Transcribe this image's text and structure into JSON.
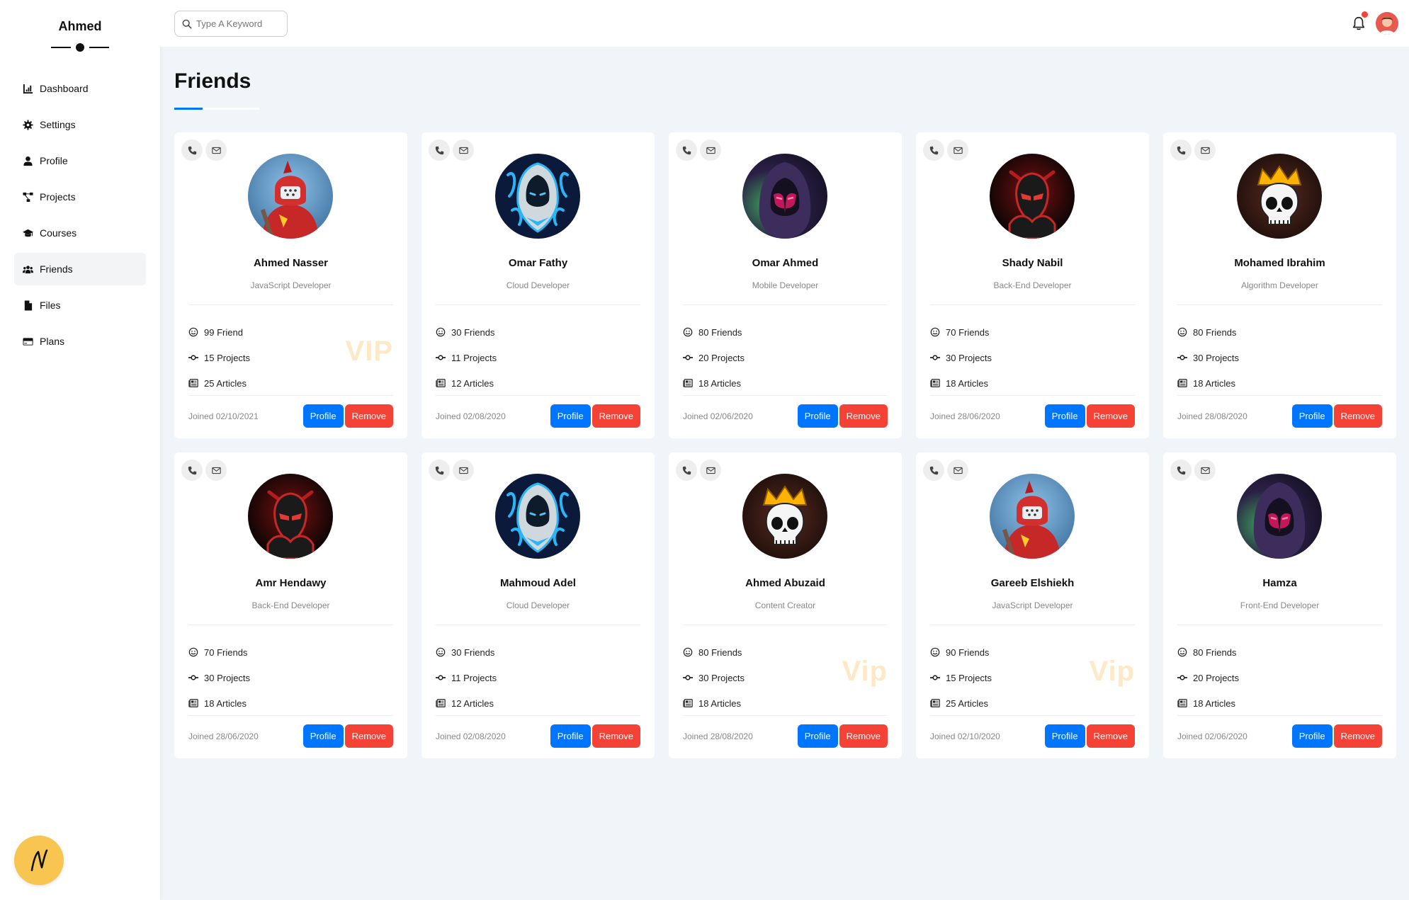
{
  "sidebar": {
    "brand": "Ahmed",
    "items": [
      {
        "label": "Dashboard",
        "icon": "chart-area-icon"
      },
      {
        "label": "Settings",
        "icon": "gear-icon"
      },
      {
        "label": "Profile",
        "icon": "user-icon"
      },
      {
        "label": "Projects",
        "icon": "diagram-project-icon"
      },
      {
        "label": "Courses",
        "icon": "graduation-cap-icon"
      },
      {
        "label": "Friends",
        "icon": "users-icon",
        "active": true
      },
      {
        "label": "Files",
        "icon": "file-icon"
      },
      {
        "label": "Plans",
        "icon": "credit-card-icon"
      }
    ]
  },
  "header": {
    "search_placeholder": "Type A Keyword"
  },
  "page": {
    "title": "Friends"
  },
  "colors": {
    "accent": "#0075ff",
    "danger": "#f44336",
    "vip": "#ffe8c6"
  },
  "buttons": {
    "profile": "Profile",
    "remove": "Remove"
  },
  "friends": [
    {
      "name": "Ahmed Nasser",
      "role": "JavaScript Developer",
      "friends": "99 Friend",
      "projects": "15 Projects",
      "articles": "25 Articles",
      "joined": "Joined 02/10/2021",
      "vip": "VIP",
      "avatar": "red-warrior"
    },
    {
      "name": "Omar Fathy",
      "role": "Cloud Developer",
      "friends": "30 Friends",
      "projects": "11 Projects",
      "articles": "12 Articles",
      "joined": "Joined 02/08/2020",
      "vip": "",
      "avatar": "blue-hood"
    },
    {
      "name": "Omar Ahmed",
      "role": "Mobile Developer",
      "friends": "80 Friends",
      "projects": "20 Projects",
      "articles": "18 Articles",
      "joined": "Joined 02/06/2020",
      "vip": "",
      "avatar": "dark-hood"
    },
    {
      "name": "Shady Nabil",
      "role": "Back-End Developer",
      "friends": "70 Friends",
      "projects": "30 Projects",
      "articles": "18 Articles",
      "joined": "Joined 28/06/2020",
      "vip": "",
      "avatar": "red-ninja"
    },
    {
      "name": "Mohamed Ibrahim",
      "role": "Algorithm Developer",
      "friends": "80 Friends",
      "projects": "30 Projects",
      "articles": "18 Articles",
      "joined": "Joined 28/08/2020",
      "vip": "",
      "avatar": "crown-skull"
    },
    {
      "name": "Amr Hendawy",
      "role": "Back-End Developer",
      "friends": "70 Friends",
      "projects": "30 Projects",
      "articles": "18 Articles",
      "joined": "Joined 28/06/2020",
      "vip": "",
      "avatar": "red-ninja"
    },
    {
      "name": "Mahmoud Adel",
      "role": "Cloud Developer",
      "friends": "30 Friends",
      "projects": "11 Projects",
      "articles": "12 Articles",
      "joined": "Joined 02/08/2020",
      "vip": "",
      "avatar": "blue-hood"
    },
    {
      "name": "Ahmed Abuzaid",
      "role": "Content Creator",
      "friends": "80 Friends",
      "projects": "30 Projects",
      "articles": "18 Articles",
      "joined": "Joined 28/08/2020",
      "vip": "Vip",
      "avatar": "crown-skull"
    },
    {
      "name": "Gareeb Elshiekh",
      "role": "JavaScript Developer",
      "friends": "90 Friends",
      "projects": "15 Projects",
      "articles": "25 Articles",
      "joined": "Joined 02/10/2020",
      "vip": "Vip",
      "avatar": "red-warrior"
    },
    {
      "name": "Hamza",
      "role": "Front-End Developer",
      "friends": "80 Friends",
      "projects": "20 Projects",
      "articles": "18 Articles",
      "joined": "Joined 02/06/2020",
      "vip": "",
      "avatar": "dark-hood"
    }
  ]
}
